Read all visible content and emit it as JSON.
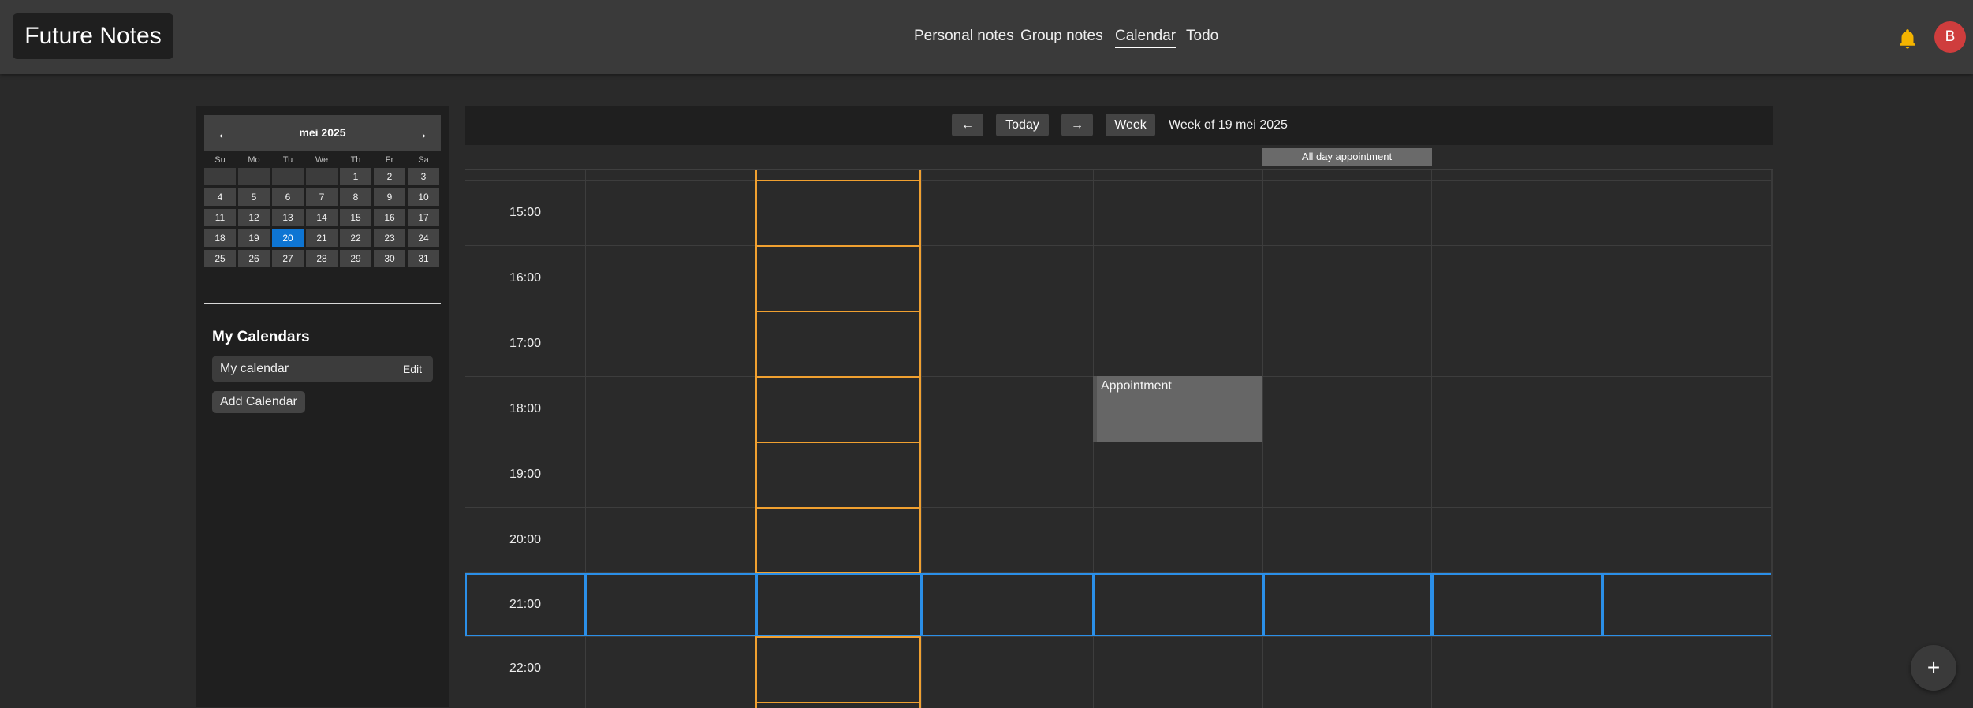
{
  "app": {
    "title": "Future Notes"
  },
  "nav": {
    "items": [
      {
        "label": "Personal notes",
        "active": false
      },
      {
        "label": "Group notes",
        "active": false
      },
      {
        "label": "Calendar",
        "active": true
      },
      {
        "label": "Todo",
        "active": false
      }
    ]
  },
  "user": {
    "avatar_initial": "B",
    "avatar_color": "#cf3d3d",
    "notification_icon": "bell-icon",
    "notification_color": "#f4b400"
  },
  "mini_calendar": {
    "title": "mei 2025",
    "prev_label": "←",
    "next_label": "→",
    "weekdays": [
      "Su",
      "Mo",
      "Tu",
      "We",
      "Th",
      "Fr",
      "Sa"
    ],
    "weeks": [
      [
        "",
        "",
        "",
        "",
        "1",
        "2",
        "3"
      ],
      [
        "4",
        "5",
        "6",
        "7",
        "8",
        "9",
        "10"
      ],
      [
        "11",
        "12",
        "13",
        "14",
        "15",
        "16",
        "17"
      ],
      [
        "18",
        "19",
        "20",
        "21",
        "22",
        "23",
        "24"
      ],
      [
        "25",
        "26",
        "27",
        "28",
        "29",
        "30",
        "31"
      ]
    ],
    "selected_day": "20",
    "selected_color": "#0e75d3"
  },
  "calendars": {
    "heading": "My Calendars",
    "items": [
      {
        "name": "My calendar",
        "edit_label": "Edit"
      }
    ],
    "add_label": "Add Calendar"
  },
  "toolbar": {
    "prev_label": "←",
    "today_label": "Today",
    "next_label": "→",
    "view_label": "Week",
    "range_label": "Week of 19 mei 2025"
  },
  "week_view": {
    "all_day_events": [
      {
        "title": "All day appointment",
        "day_index": 4
      }
    ],
    "hours": [
      "15:00",
      "16:00",
      "17:00",
      "18:00",
      "19:00",
      "20:00",
      "21:00",
      "22:00"
    ],
    "today_column_index": 1,
    "today_color": "#f0a030",
    "current_hour": "21:00",
    "current_hour_color": "#2b8fe8",
    "events": [
      {
        "title": "Appointment",
        "day_index": 3,
        "start": "18:00",
        "end": "19:00"
      }
    ]
  },
  "fab": {
    "label": "+"
  }
}
